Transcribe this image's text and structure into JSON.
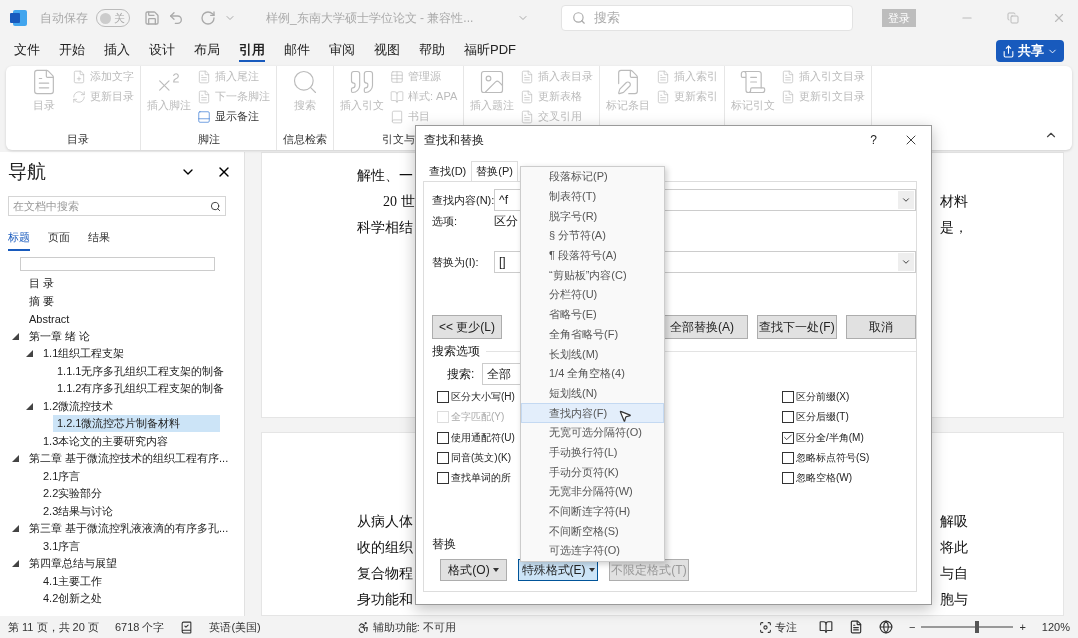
{
  "title_bar": {
    "autosave_label": "自动保存",
    "autosave_toggle": {
      "on": false,
      "text": "关"
    },
    "document_title": "样例_东南大学硕士学位论文 - 兼容性...",
    "search_placeholder": "搜索",
    "login_button": "登录"
  },
  "menu_tabs": [
    {
      "label": "文件",
      "selected": false
    },
    {
      "label": "开始",
      "selected": false
    },
    {
      "label": "插入",
      "selected": false
    },
    {
      "label": "设计",
      "selected": false
    },
    {
      "label": "布局",
      "selected": false
    },
    {
      "label": "引用",
      "selected": true
    },
    {
      "label": "邮件",
      "selected": false
    },
    {
      "label": "审阅",
      "selected": false
    },
    {
      "label": "视图",
      "selected": false
    },
    {
      "label": "帮助",
      "selected": false
    },
    {
      "label": "福昕PDF",
      "selected": false
    }
  ],
  "share_button": "共享",
  "ribbon": {
    "groups": [
      {
        "label": "目录",
        "items": [
          {
            "kind": "large",
            "label": "目录",
            "disabled": true
          },
          {
            "kind": "small",
            "label": "添加文字",
            "disabled": true
          },
          {
            "kind": "small",
            "label": "更新目录",
            "disabled": true
          }
        ]
      },
      {
        "label": "脚注",
        "items": [
          {
            "kind": "large",
            "label": "插入脚注",
            "disabled": true
          },
          {
            "kind": "small",
            "label": "插入尾注",
            "disabled": true
          },
          {
            "kind": "small",
            "label": "下一条脚注",
            "disabled": true
          },
          {
            "kind": "small",
            "label": "显示备注",
            "disabled": false
          }
        ]
      },
      {
        "label": "信息检索",
        "items": [
          {
            "kind": "large",
            "label": "搜索",
            "disabled": true
          }
        ]
      },
      {
        "label": "引文与",
        "items": [
          {
            "kind": "large",
            "label": "插入引文",
            "disabled": true
          },
          {
            "kind": "small",
            "label": "管理源",
            "disabled": true
          },
          {
            "kind": "small",
            "label": "样式: APA",
            "disabled": true
          },
          {
            "kind": "small",
            "label": "书目",
            "disabled": true
          }
        ]
      },
      {
        "items": [
          {
            "kind": "large",
            "label": "插入题注",
            "disabled": true
          },
          {
            "kind": "small",
            "label": "插入表目录",
            "disabled": true
          },
          {
            "kind": "small",
            "label": "更新表格",
            "disabled": true
          },
          {
            "kind": "small",
            "label": "交叉引用",
            "disabled": true
          }
        ]
      },
      {
        "items": [
          {
            "kind": "large",
            "label": "标记条目",
            "disabled": true
          },
          {
            "kind": "small",
            "label": "插入索引",
            "disabled": true
          },
          {
            "kind": "small",
            "label": "更新索引",
            "disabled": true
          }
        ]
      },
      {
        "items": [
          {
            "kind": "large",
            "label": "标记引文",
            "disabled": true
          },
          {
            "kind": "small",
            "label": "插入引文目录",
            "disabled": true
          },
          {
            "kind": "small",
            "label": "更新引文目录",
            "disabled": true
          }
        ]
      }
    ]
  },
  "navigation": {
    "title": "导航",
    "search_placeholder": "在文档中搜索",
    "tabs": [
      {
        "label": "标题",
        "selected": true
      },
      {
        "label": "页面",
        "selected": false
      },
      {
        "label": "结果",
        "selected": false
      }
    ],
    "tree": [
      {
        "label": "目 录",
        "selected": false
      },
      {
        "label": "摘 要",
        "selected": false
      },
      {
        "label": "Abstract",
        "selected": false
      },
      {
        "label": "第一章 绪 论",
        "selected": false,
        "expanded": true,
        "children": [
          {
            "label": "1.1组织工程支架",
            "selected": false,
            "expanded": true,
            "children": [
              {
                "label": "1.1.1无序多孔组织工程支架的制备",
                "selected": false
              },
              {
                "label": "1.1.2有序多孔组织工程支架的制备",
                "selected": false
              }
            ]
          },
          {
            "label": "1.2微流控技术",
            "selected": false,
            "expanded": true,
            "children": [
              {
                "label": "1.2.1微流控芯片制备材料",
                "selected": true
              }
            ]
          },
          {
            "label": "1.3本论文的主要研究内容",
            "selected": false
          }
        ]
      },
      {
        "label": "第二章 基于微流控技术的组织工程有序...",
        "selected": false,
        "expanded": true,
        "children": [
          {
            "label": "2.1序言",
            "selected": false
          },
          {
            "label": "2.2实验部分",
            "selected": false
          },
          {
            "label": "2.3结果与讨论",
            "selected": false
          }
        ]
      },
      {
        "label": "第三章 基于微流控乳液液滴的有序多孔...",
        "selected": false,
        "expanded": true,
        "children": [
          {
            "label": "3.1序言",
            "selected": false
          }
        ]
      },
      {
        "label": "第四章总结与展望",
        "selected": false,
        "expanded": true,
        "children": [
          {
            "label": "4.1主要工作",
            "selected": false
          },
          {
            "label": "4.2创新之处",
            "selected": false
          }
        ]
      }
    ]
  },
  "document": {
    "pages": [
      {
        "lines": [
          {
            "left": "解性、一",
            "indent": false
          },
          {
            "left": "20 世",
            "right": "材料",
            "indent": true
          },
          {
            "left": "科学相结",
            "right": "是，",
            "indent": false
          }
        ]
      },
      {
        "lines": [
          {
            "left": "从病人体",
            "right": "解吸",
            "indent": false
          },
          {
            "left": "收的组织",
            "right": "将此",
            "indent": false
          },
          {
            "left": "复合物程",
            "right": "与自",
            "indent": false
          },
          {
            "left": "身功能和",
            "right": "胞与",
            "indent": false
          }
        ]
      }
    ]
  },
  "dialog": {
    "title": "查找和替换",
    "help": "?",
    "tabs": [
      {
        "label": "查找(D)",
        "selected": false
      },
      {
        "label": "替换(P)",
        "selected": true
      }
    ],
    "find_label": "查找内容(N):",
    "find_value": "^f",
    "options_label": "选项:",
    "options_value": "区分",
    "replace_label": "替换为(I):",
    "replace_value": "[]",
    "more_button": "<< 更少(L)",
    "action_buttons": [
      "全部替换(A)",
      "查找下一处(F)",
      "取消"
    ],
    "search_options_title": "搜索选项",
    "search_label": "搜索:",
    "search_value": "全部",
    "left_options": [
      {
        "label": "区分大小写(H)",
        "checked": false,
        "disabled": false
      },
      {
        "label": "全字匹配(Y)",
        "checked": false,
        "disabled": true
      },
      {
        "label": "使用通配符(U)",
        "checked": false,
        "disabled": false
      },
      {
        "label": "同音(英文)(K)",
        "checked": false,
        "disabled": false
      },
      {
        "label": "查找单词的所",
        "checked": false,
        "disabled": false
      }
    ],
    "right_options": [
      {
        "label": "区分前缀(X)",
        "checked": false,
        "disabled": false
      },
      {
        "label": "区分后缀(T)",
        "checked": false,
        "disabled": false
      },
      {
        "label": "区分全/半角(M)",
        "checked": true,
        "disabled": false
      },
      {
        "label": "忽略标点符号(S)",
        "checked": false,
        "disabled": false
      },
      {
        "label": "忽略空格(W)",
        "checked": false,
        "disabled": false
      }
    ],
    "replace_section_title": "替换",
    "bottom_buttons": [
      {
        "label": "格式(O)",
        "menu": true,
        "active": false,
        "disabled": false
      },
      {
        "label": "特殊格式(E)",
        "menu": true,
        "active": true,
        "disabled": false
      },
      {
        "label": "不限定格式(T)",
        "menu": false,
        "active": false,
        "disabled": true
      }
    ],
    "special_menu": [
      {
        "label": "段落标记(P)",
        "selected": false
      },
      {
        "label": "制表符(T)",
        "selected": false
      },
      {
        "label": "脱字号(R)",
        "selected": false
      },
      {
        "label": "§ 分节符(A)",
        "selected": false
      },
      {
        "label": "¶ 段落符号(A)",
        "selected": false
      },
      {
        "label": "“剪贴板”内容(C)",
        "selected": false
      },
      {
        "label": "分栏符(U)",
        "selected": false
      },
      {
        "label": "省略号(E)",
        "selected": false
      },
      {
        "label": "全角省略号(F)",
        "selected": false
      },
      {
        "label": "长划线(M)",
        "selected": false
      },
      {
        "label": "1/4 全角空格(4)",
        "selected": false
      },
      {
        "label": "短划线(N)",
        "selected": false
      },
      {
        "label": "查找内容(F)",
        "selected": true
      },
      {
        "label": "无宽可选分隔符(O)",
        "selected": false
      },
      {
        "label": "手动换行符(L)",
        "selected": false
      },
      {
        "label": "手动分页符(K)",
        "selected": false
      },
      {
        "label": "无宽非分隔符(W)",
        "selected": false
      },
      {
        "label": "不间断连字符(H)",
        "selected": false
      },
      {
        "label": "不间断空格(S)",
        "selected": false
      },
      {
        "label": "可选连字符(O)",
        "selected": false
      }
    ]
  },
  "status_bar": {
    "page_info": "第 11 页，共 20 页",
    "word_count": "6718 个字",
    "language": "英语(美国)",
    "accessibility": "辅助功能: 不可用",
    "focus": "专注",
    "zoom_out": "−",
    "zoom_in": "+",
    "zoom": {
      "level": 0.6
    },
    "zoom_percent": "120%"
  }
}
